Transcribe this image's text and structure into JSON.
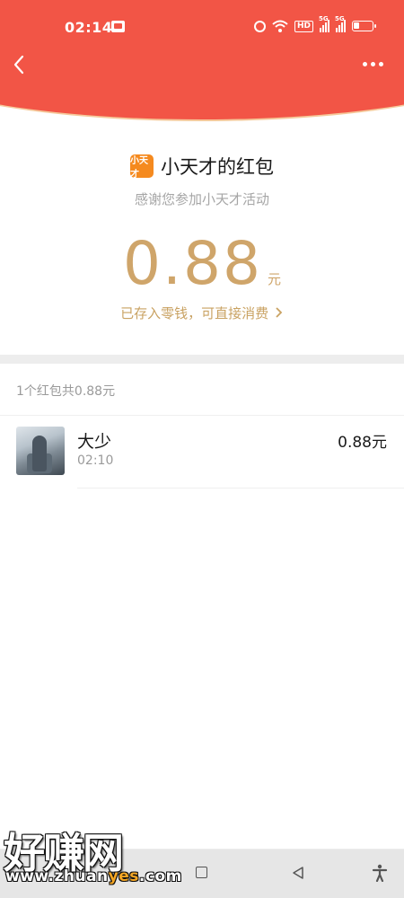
{
  "status_bar": {
    "time": "02:14",
    "hd": "HD",
    "signal1": "5G",
    "signal2": "5G",
    "icons": [
      "app-notification-icon",
      "alarm-icon",
      "wifi-icon",
      "hd-icon",
      "signal-5g-icon",
      "signal-5g-icon",
      "battery-icon"
    ]
  },
  "nav": {
    "back_icon": "chevron-left-icon",
    "more_icon": "more-dots-icon"
  },
  "sender": {
    "logo_text": "小天才",
    "name": "小天才的红包",
    "greeting": "感谢您参加小天才活动"
  },
  "amount": {
    "value": "0.88",
    "unit": "元",
    "saved_text": "已存入零钱，可直接消费",
    "saved_chevron": "›"
  },
  "list": {
    "summary": "1个红包共0.88元",
    "items": [
      {
        "name": "大少",
        "time": "02:10",
        "amount": "0.88元"
      }
    ]
  },
  "watermark": {
    "title": "好赚网",
    "url_prefix": "www.zhuan",
    "url_highlight": "yes",
    "url_suffix": ".com"
  },
  "colors": {
    "header_red": "#f25546",
    "gold": "#cfa56a",
    "logo_orange": "#f58a1f"
  }
}
